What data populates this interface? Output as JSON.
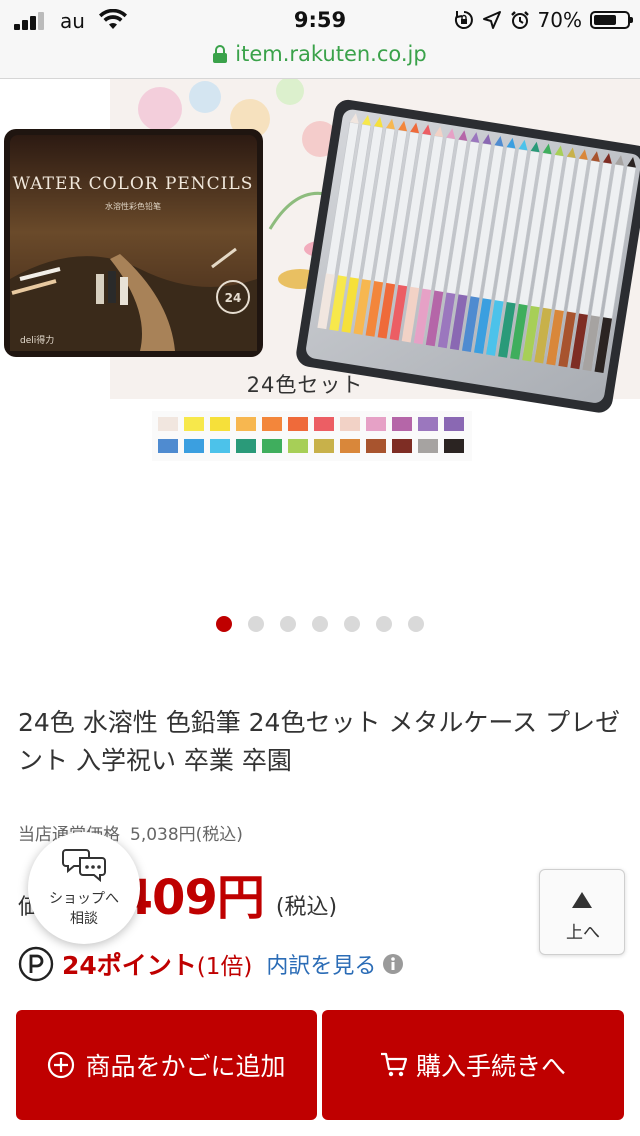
{
  "status_bar": {
    "carrier": "au",
    "time": "9:59",
    "battery_percent": "70%",
    "battery_level": 0.7,
    "icons": [
      "signal-icon",
      "wifi-icon",
      "rotation-lock-icon",
      "location-icon",
      "alarm-icon",
      "battery-icon"
    ]
  },
  "browser": {
    "url": "item.rakuten.co.jp"
  },
  "gallery": {
    "pencil_tin_title": "WATER COLOR PENCILS",
    "pencil_tin_subtitle": "水溶性彩色铅笔",
    "tin_badge": "24",
    "brand": "deli得力",
    "set_label": "24色セット",
    "swatch_colors": [
      "#f1e6df",
      "#f7e84b",
      "#f6e03a",
      "#f7b750",
      "#f3863b",
      "#ef6a3a",
      "#ec5e64",
      "#f2d2c6",
      "#e6a1c6",
      "#b566a8",
      "#9b77be",
      "#8a68b3",
      "#4f8bd0",
      "#3b9fe0",
      "#4cc2ea",
      "#2a9a79",
      "#3fae5d",
      "#a7cf57",
      "#c8b14a",
      "#d9873a",
      "#a8542e",
      "#7e2d24",
      "#a6a3a1",
      "#2b2422"
    ],
    "page_count": 7,
    "active_page": 1
  },
  "product": {
    "title": "24色 水溶性 色鉛筆 24色セット メタルケース プレゼント 入学祝い 卒業 卒園",
    "orig_price_label": "当店通常価格",
    "orig_price": "5,038円(税込)",
    "price_label": "価格",
    "price": "2,409円",
    "tax": "(税込)",
    "points": "24ポイント",
    "multiplier": "(1倍)",
    "breakdown": "内訳を見る"
  },
  "floating": {
    "shop_line1": "ショップへ",
    "shop_line2": "相談",
    "top_label": "上へ"
  },
  "buttons": {
    "cart": "商品をかごに追加",
    "buy": "購入手続きへ"
  },
  "colors": {
    "accent": "#bf0000",
    "link": "#2b6cb6",
    "secure": "#3aa24a"
  }
}
